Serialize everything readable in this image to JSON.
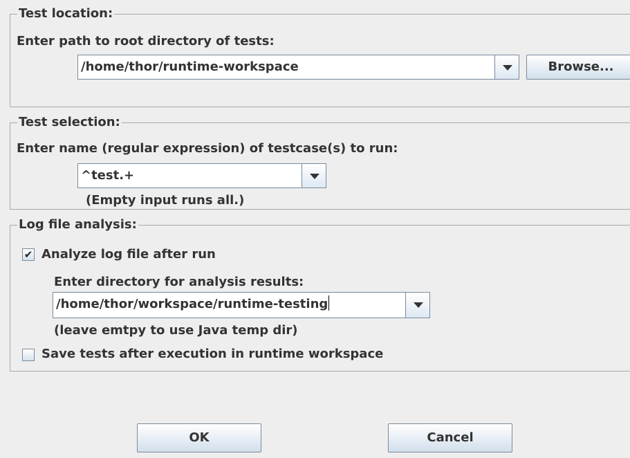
{
  "test_location": {
    "legend": "Test location:",
    "prompt": "Enter path to root directory of tests:",
    "path_value": "/home/thor/runtime-workspace",
    "browse_label": "Browse..."
  },
  "test_selection": {
    "legend": "Test selection:",
    "prompt": "Enter name (regular expression) of testcase(s) to run:",
    "pattern_value": "^test.+",
    "hint": "(Empty input runs all.)"
  },
  "log_analysis": {
    "legend": "Log file analysis:",
    "analyze_label": "Analyze log file after run",
    "analyze_checked": true,
    "analyze_check_glyph": "✔",
    "dir_prompt": "Enter directory for analysis results:",
    "dir_value": "/home/thor/workspace/runtime-testing",
    "dir_hint": "(leave emtpy to use Java temp dir)",
    "save_label": "Save tests after execution in runtime workspace",
    "save_checked": false
  },
  "buttons": {
    "ok": "OK",
    "cancel": "Cancel"
  }
}
